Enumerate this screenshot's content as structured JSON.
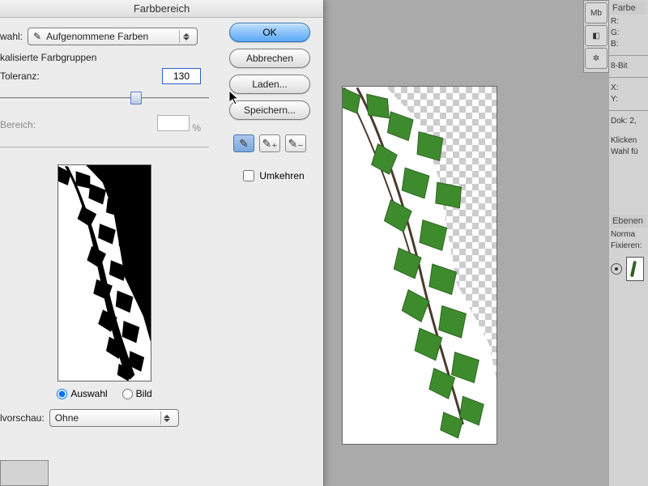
{
  "dialog": {
    "title": "Farbbereich",
    "auswahl_label": "wahl:",
    "combobox_value": "Aufgenommene Farben",
    "section_head": "kalisierte Farbgruppen",
    "tolerance_label": "Toleranz:",
    "tolerance_value": "130",
    "bereich_label": "Bereich:",
    "bereich_unit": "%",
    "radio_auswahl": "Auswahl",
    "radio_bild": "Bild",
    "vorschau_label": "lvorschau:",
    "vorschau_value": "Ohne",
    "buttons": {
      "ok": "OK",
      "cancel": "Abbrechen",
      "load": "Laden...",
      "save": "Speichern..."
    },
    "invert_label": "Umkehren"
  },
  "sidebar": {
    "farbe_tab": "Farbe",
    "rgb_r": "R:",
    "rgb_g": "G:",
    "rgb_b": "B:",
    "bit_depth": "8-Bit",
    "pos_x": "X:",
    "pos_y": "Y:",
    "doc_label": "Dok: 2,",
    "hint1": "Klicken",
    "hint2": "Wahl fü",
    "layers_tab": "Ebenen",
    "blend_mode": "Norma",
    "lock_label": "Fixieren:"
  }
}
